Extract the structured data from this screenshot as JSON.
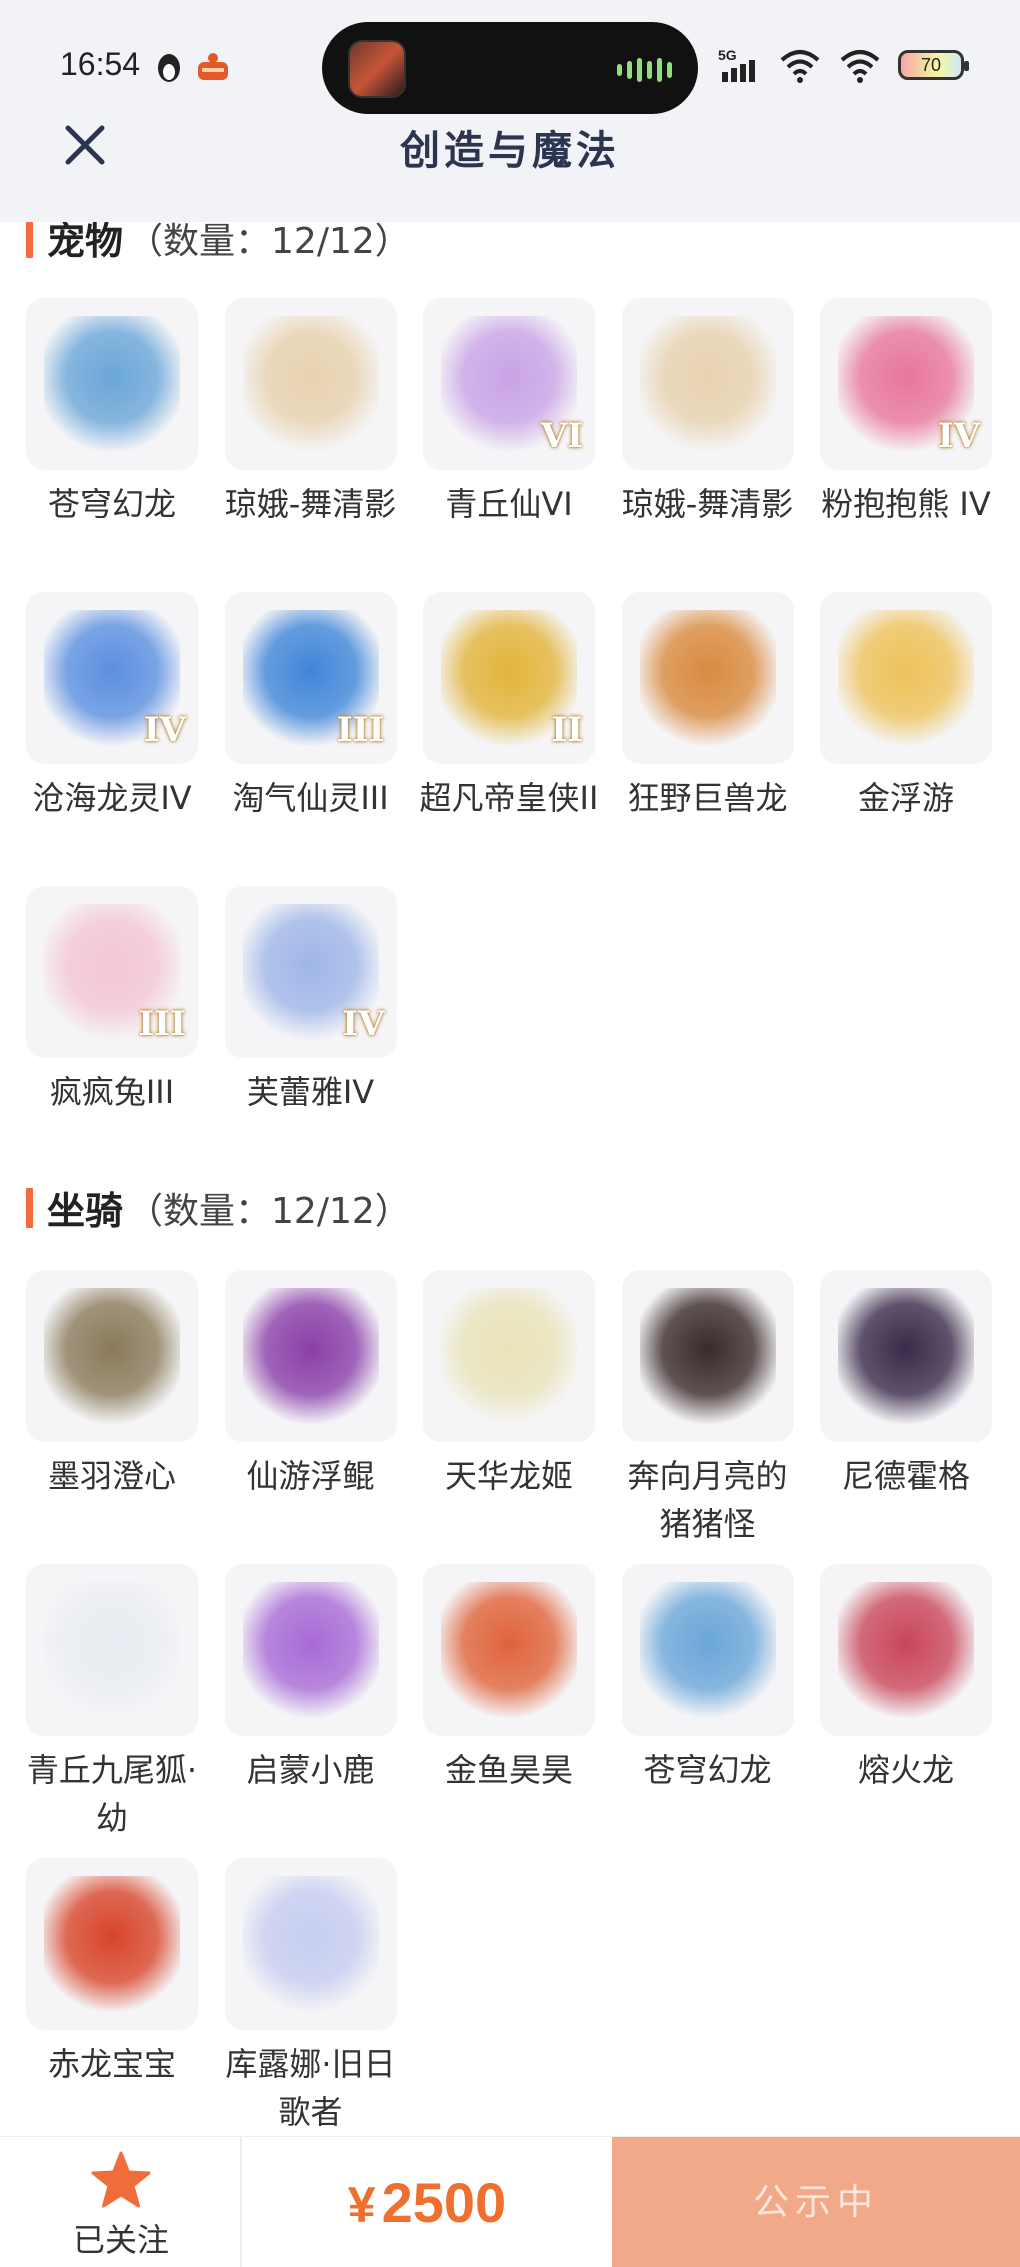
{
  "status_bar": {
    "time": "16:54",
    "network": "5G",
    "battery": "70"
  },
  "header": {
    "title": "创造与魔法"
  },
  "pets": {
    "label": "宠物",
    "count": "（数量：12/12）",
    "items": [
      {
        "name": "苍穹幻龙",
        "badge": "",
        "color": "#6aa6d8"
      },
      {
        "name": "琼娥-舞清影",
        "badge": "",
        "color": "#e8d2b0"
      },
      {
        "name": "青丘仙VI",
        "badge": "VI",
        "color": "#c9a3e6"
      },
      {
        "name": "琼娥-舞清影",
        "badge": "",
        "color": "#e8d2b0"
      },
      {
        "name": "粉抱抱熊 IV",
        "badge": "IV",
        "color": "#e8769a"
      },
      {
        "name": "沧海龙灵IV",
        "badge": "IV",
        "color": "#5b8fe0"
      },
      {
        "name": "淘气仙灵III",
        "badge": "III",
        "color": "#3f86d8"
      },
      {
        "name": "超凡帝皇侠II",
        "badge": "II",
        "color": "#e3b43a"
      },
      {
        "name": "狂野巨兽龙",
        "badge": "",
        "color": "#d98a3e"
      },
      {
        "name": "金浮游",
        "badge": "",
        "color": "#eec25a"
      },
      {
        "name": "疯疯兔III",
        "badge": "III",
        "color": "#f4c6d6"
      },
      {
        "name": "芙蕾雅IV",
        "badge": "IV",
        "color": "#9fb6e8"
      }
    ]
  },
  "mounts": {
    "label": "坐骑",
    "count": "（数量：12/12）",
    "items": [
      {
        "name": "墨羽澄心",
        "badge": "",
        "color": "#8a7a5a"
      },
      {
        "name": "仙游浮鲲",
        "badge": "",
        "color": "#8a3fa8"
      },
      {
        "name": "天华龙姬",
        "badge": "",
        "color": "#e9e3b8"
      },
      {
        "name": "奔向月亮的猪猪怪",
        "badge": "",
        "color": "#3a2a2a"
      },
      {
        "name": "尼德霍格",
        "badge": "",
        "color": "#3a2a4a"
      },
      {
        "name": "青丘九尾狐·幼",
        "badge": "",
        "color": "#e9ecf2"
      },
      {
        "name": "启蒙小鹿",
        "badge": "",
        "color": "#a86ad6"
      },
      {
        "name": "金鱼昊昊",
        "badge": "",
        "color": "#e0633a"
      },
      {
        "name": "苍穹幻龙",
        "badge": "",
        "color": "#6aa6d8"
      },
      {
        "name": "熔火龙",
        "badge": "",
        "color": "#c9465a"
      },
      {
        "name": "赤龙宝宝",
        "badge": "",
        "color": "#d8452a"
      },
      {
        "name": "库露娜·旧日歌者",
        "badge": "",
        "color": "#c6cdf0"
      }
    ]
  },
  "bottom_bar": {
    "follow_label": "已关注",
    "currency": "¥",
    "price": "2500",
    "status_label": "公示中"
  },
  "colors": {
    "accent": "#f06c3a",
    "price": "#ef6f2e",
    "status_button": "#f2a98a"
  }
}
